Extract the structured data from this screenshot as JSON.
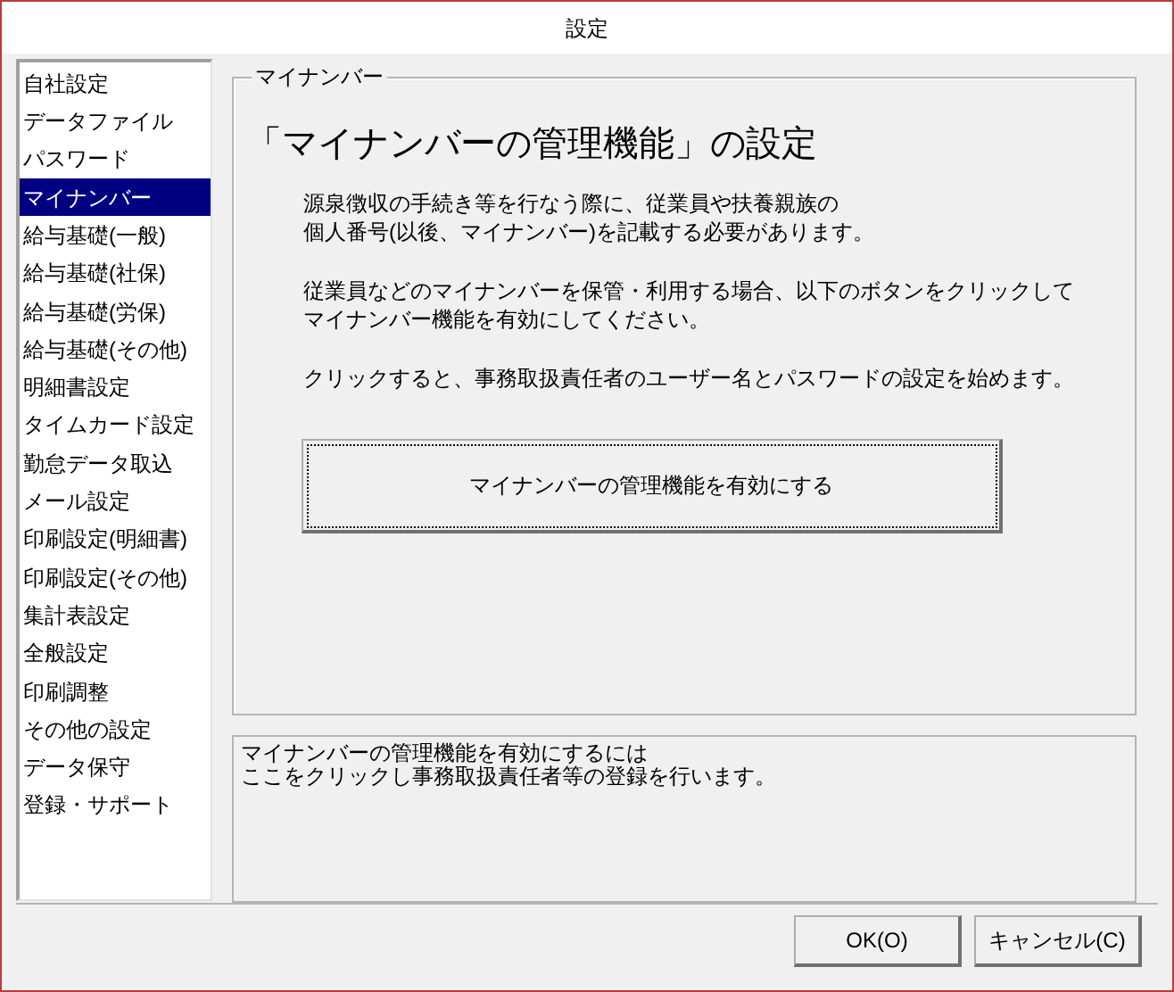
{
  "window": {
    "title": "設定"
  },
  "sidebar": {
    "items": [
      {
        "label": "自社設定",
        "selected": false
      },
      {
        "label": "データファイル",
        "selected": false
      },
      {
        "label": "パスワード",
        "selected": false
      },
      {
        "label": "マイナンバー",
        "selected": true
      },
      {
        "label": "給与基礎(一般)",
        "selected": false
      },
      {
        "label": "給与基礎(社保)",
        "selected": false
      },
      {
        "label": "給与基礎(労保)",
        "selected": false
      },
      {
        "label": "給与基礎(その他)",
        "selected": false
      },
      {
        "label": "明細書設定",
        "selected": false
      },
      {
        "label": "タイムカード設定",
        "selected": false
      },
      {
        "label": "勤怠データ取込",
        "selected": false
      },
      {
        "label": "メール設定",
        "selected": false
      },
      {
        "label": "印刷設定(明細書)",
        "selected": false
      },
      {
        "label": "印刷設定(その他)",
        "selected": false
      },
      {
        "label": "集計表設定",
        "selected": false
      },
      {
        "label": "全般設定",
        "selected": false
      },
      {
        "label": "印刷調整",
        "selected": false
      },
      {
        "label": "その他の設定",
        "selected": false
      },
      {
        "label": "データ保守",
        "selected": false
      },
      {
        "label": "登録・サポート",
        "selected": false
      }
    ]
  },
  "group": {
    "title": "マイナンバー",
    "heading": "「マイナンバーの管理機能」の設定",
    "paragraphs": [
      [
        "源泉徴収の手続き等を行なう際に、従業員や扶養親族の",
        "個人番号(以後、マイナンバー)を記載する必要があります。"
      ],
      [
        "従業員などのマイナンバーを保管・利用する場合、以下のボタンをクリックして",
        "マイナンバー機能を有効にしてください。"
      ],
      [
        "クリックすると、事務取扱責任者のユーザー名とパスワードの設定を始めます。"
      ]
    ],
    "button": "マイナンバーの管理機能を有効にする"
  },
  "info": [
    "マイナンバーの管理機能を有効にするには",
    "ここをクリックし事務取扱責任者等の登録を行います。"
  ],
  "buttons": [
    "OK(O)",
    "キャンセル(C)"
  ]
}
